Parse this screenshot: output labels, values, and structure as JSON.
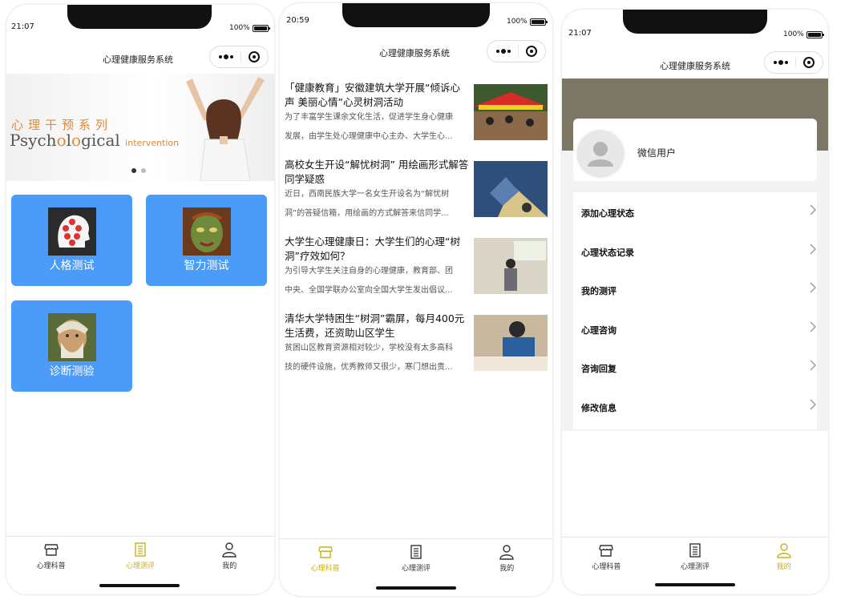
{
  "screens": [
    {
      "status": {
        "time": "21:07",
        "battery": "100%"
      },
      "nav_title": "心理健康服务系统",
      "banner": {
        "cn": "心理干预系列",
        "en_part1": "Psych",
        "en_o": "o",
        "en_part2": "l",
        "en_o2": "o",
        "en_part3": "gical",
        "en_small": "intervention"
      },
      "tiles": [
        {
          "label": "人格测试",
          "icon": "head-diagram-icon"
        },
        {
          "label": "智力测试",
          "icon": "face-painting-icon"
        },
        {
          "label": "诊断测验",
          "icon": "portrait-icon"
        }
      ],
      "tabs": [
        {
          "label": "心理科普",
          "icon": "shop-icon",
          "active": false
        },
        {
          "label": "心理测评",
          "icon": "list-icon",
          "active": true
        },
        {
          "label": "我的",
          "icon": "user-icon",
          "active": false
        }
      ]
    },
    {
      "status": {
        "time": "20:59",
        "battery": "100%"
      },
      "nav_title": "心理健康服务系统",
      "news": [
        {
          "title": "「健康教育」安徽建筑大学开展“倾诉心声 美丽心情”心灵树洞活动",
          "summary_line1": "为了丰富学生课余文化生活，促进学生身心健康",
          "summary_line2": "发展，由学生处心理健康中心主办、大学生心..."
        },
        {
          "title": "高校女生开设“解忧树洞” 用绘画形式解答同学疑惑",
          "summary_line1": "近日，西南民族大学一名女生开设名为“解忧树",
          "summary_line2": "洞”的答疑信箱，用绘画的方式解答来信同学..."
        },
        {
          "title": "大学生心理健康日：大学生们的心理“树洞”疗效如何？",
          "summary_line1": "为引导大学生关注自身的心理健康，教育部、团",
          "summary_line2": "中央、全国学联办公室向全国大学生发出倡议..."
        },
        {
          "title": "清华大学特困生“树洞”霸屏，每月400元生活费，还资助山区学生",
          "summary_line1": "贫困山区教育资源相对较少，学校没有太多高科",
          "summary_line2": "技的硬件设施，优秀教师又很少，寒门想出贵..."
        }
      ],
      "tabs": [
        {
          "label": "心理科普",
          "icon": "shop-icon",
          "active": true
        },
        {
          "label": "心理测评",
          "icon": "list-icon",
          "active": false
        },
        {
          "label": "我的",
          "icon": "user-icon",
          "active": false
        }
      ]
    },
    {
      "status": {
        "time": "21:07",
        "battery": "100%"
      },
      "nav_title": "心理健康服务系统",
      "user_name": "微信用户",
      "menu": [
        {
          "label": "添加心理状态"
        },
        {
          "label": "心理状态记录"
        },
        {
          "label": "我的测评"
        },
        {
          "label": "心理咨询"
        },
        {
          "label": "咨询回复"
        },
        {
          "label": "修改信息"
        }
      ],
      "tabs": [
        {
          "label": "心理科普",
          "icon": "shop-icon",
          "active": false
        },
        {
          "label": "心理测评",
          "icon": "list-icon",
          "active": false
        },
        {
          "label": "我的",
          "icon": "user-icon",
          "active": true
        }
      ]
    }
  ],
  "colors": {
    "tile_blue": "#4b9cf9",
    "active_tab": "#c8b020",
    "profile_header": "#7b7764"
  }
}
